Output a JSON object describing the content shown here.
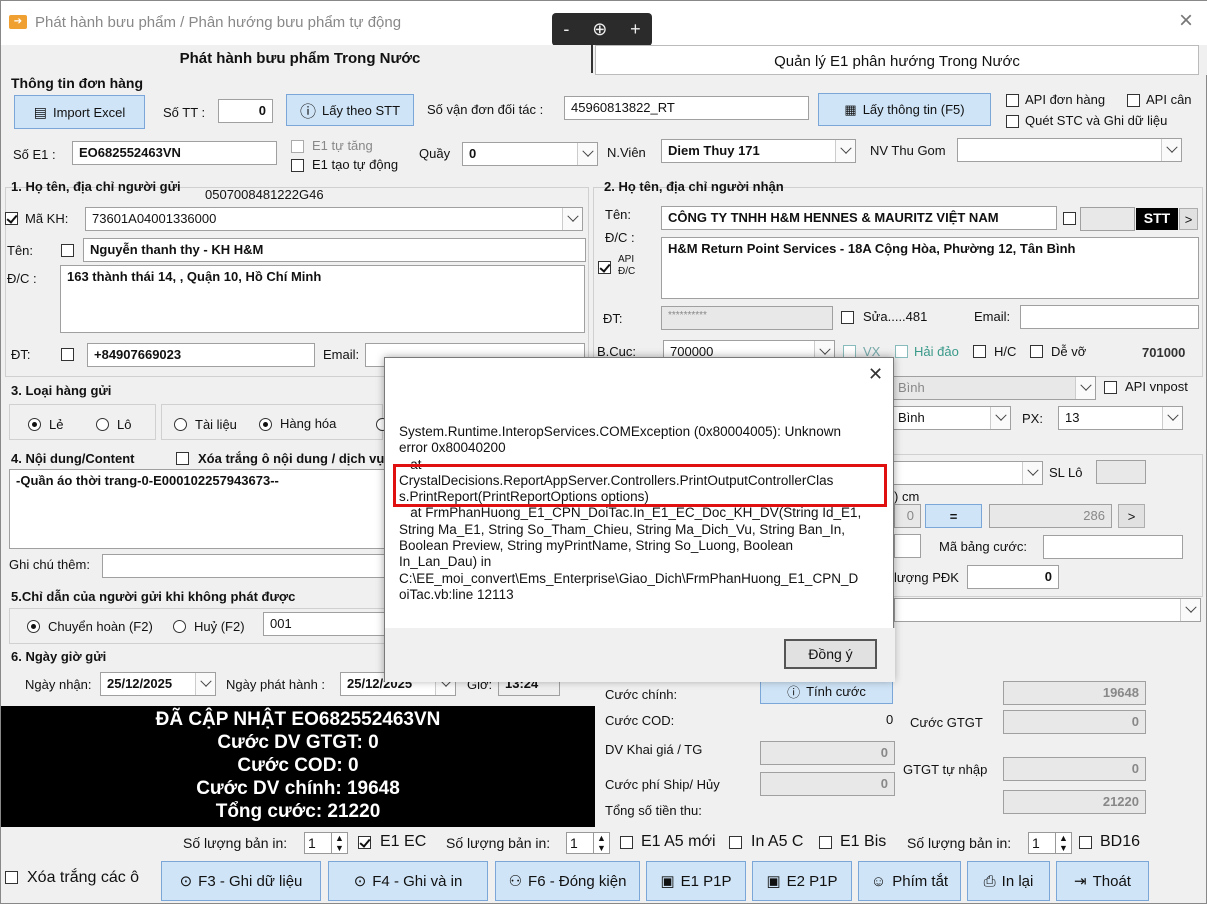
{
  "window": {
    "title": "Phát hành bưu phẩm / Phân hướng bưu phẩm tự động",
    "close": "×"
  },
  "zoom": {
    "minus": "-",
    "plus": "+"
  },
  "tabs": [
    "Phát hành bưu phẩm Trong Nước",
    "Quản lý E1 phân hướng Trong Nước"
  ],
  "order": {
    "section": "Thông tin đơn hàng",
    "import_label": "Import Excel",
    "stt_label": "Số TT :",
    "stt_value": "0",
    "get_by_stt": "Lấy theo STT",
    "partner_label": "Số vận đơn đối tác :",
    "partner_value": "45960813822_RT",
    "get_info": "Lấy thông tin (F5)",
    "api_order": "API đơn hàng",
    "api_scale": "API cân",
    "scan_stc": "Quét STC và Ghi dữ liệu"
  },
  "e1": {
    "label": "Số E1 :",
    "value": "EO682552463VN",
    "auto_inc": "E1 tự tăng",
    "auto_create": "E1 tạo tự động",
    "counter_label": "Quầy",
    "counter_value": "0",
    "staff_label": "N.Viên",
    "staff_value": "Diem Thuy 171",
    "collector_label": "NV Thu Gom",
    "collector_value": ""
  },
  "sender": {
    "section": "1. Họ tên, địa chỉ người gửi",
    "ref": "0507008481222G46",
    "customer_label": "Mã KH:",
    "customer_value": "73601A04001336000",
    "name_label": "Tên:",
    "name_value": "Nguyễn thanh thy - KH H&M",
    "addr_label": "Đ/C :",
    "addr_value": "163 thành thái 14, , Quận 10, Hồ Chí Minh",
    "phone_label": "ĐT:",
    "phone_value": "+84907669023",
    "email_label": "Email:"
  },
  "receiver": {
    "section": "2. Họ tên, địa chỉ người nhận",
    "name_label": "Tên:",
    "name_value": "CÔNG TY TNHH H&M HENNES & MAURITZ VIỆT NAM",
    "stt": "STT",
    "next": ">",
    "addr_label": "Đ/C :",
    "addr_value": "H&M Return Point Services - 18A Cộng Hòa, Phường 12, Tân Bình",
    "api_dc": "API Đ/C",
    "phone_label": "ĐT:",
    "phone_value": "**********",
    "edit_label": "Sửa.....481",
    "email_label": "Email:",
    "bc_label": "B.Cục:",
    "bc_value": "700000",
    "vx": "VX",
    "island": "Hải đảo",
    "hc": "H/C",
    "fragile": "Dễ vỡ",
    "post_code": "701000",
    "district_value": "Bình",
    "api_vnpost": "API vnpost",
    "ward_value": "Bình",
    "px_label": "PX:",
    "px_value": "13"
  },
  "goods": {
    "section": "3. Loại hàng gửi",
    "single": "Lẻ",
    "lot": "Lô",
    "docs": "Tài liệu",
    "goods": "Hàng hóa"
  },
  "content": {
    "section": "4. Nội dung/Content",
    "clear_label": "Xóa trắng ô nội dung / dịch vụ",
    "value": "-Quần áo thời trang-0-E000102257943673--",
    "note_label": "Ghi chú thêm:"
  },
  "service": {
    "sl_lo": "SL Lô",
    "cm": ") cm",
    "dim_value": "0",
    "equals": "=",
    "result": "286",
    "next": ">",
    "price_table_label": "Mã bảng cước:",
    "pdk_label": "lượng PĐK",
    "pdk_value": "0"
  },
  "undeliver": {
    "section": "5.Chỉ dẫn của người gửi khi không phát được",
    "return": "Chuyển hoàn (F2)",
    "cancel": "Huỷ (F2)",
    "code": "001"
  },
  "dates": {
    "section": "6. Ngày giờ gửi",
    "recv_label": "Ngày nhận:",
    "recv_value": "25/12/2025",
    "issue_label": "Ngày phát hành :",
    "issue_value": "25/12/2025",
    "time_label": "Giờ:",
    "time_value": "13:24"
  },
  "fees": {
    "main_label": "Cước chính:",
    "calc_button": "Tính cước",
    "main_value": "19648",
    "cod_label": "Cước COD:",
    "cod_value": "0",
    "gtgt_label": "Cước GTGT",
    "gtgt_value": "0",
    "declared_label": "DV Khai giá / TG",
    "declared_value": "0",
    "gtgt_input_label": "GTGT tự nhập",
    "gtgt_input_value": "0",
    "ship_label": "Cước phí Ship/ Hủy",
    "ship_value": "0",
    "total_label": "Tổng số tiền thu:",
    "total_value": "21220"
  },
  "status": [
    "ĐÃ CẬP NHẬT EO682552463VN",
    "Cước DV GTGT: 0",
    "Cước COD: 0",
    "Cước DV chính: 19648",
    "Tổng cước: 21220"
  ],
  "print": {
    "qty_label": "Số lượng bản in:",
    "qty1": "1",
    "e1ec": "E1 EC",
    "qty2": "1",
    "e1a5": "E1 A5 mới",
    "ina5c": "In A5 C",
    "e1bis": "E1 Bis",
    "qty3": "1",
    "bd16": "BD16"
  },
  "footer": {
    "clear_all": "Xóa trắng các ô",
    "f3": "F3 - Ghi dữ liệu",
    "f4": "F4 - Ghi và in",
    "f6": "F6 - Đóng kiện",
    "e1p1p": "E1 P1P",
    "e2p1p": "E2 P1P",
    "shortcut": "Phím tắt",
    "reprint": "In lại",
    "exit": "Thoát"
  },
  "dialog": {
    "close": "✕",
    "line1": "System.Runtime.InteropServices.COMException (0x80004005): Unknown",
    "line2": "error 0x80040200",
    "line3": "   at",
    "line4": "CrystalDecisions.ReportAppServer.Controllers.PrintOutputControllerClas",
    "line5": "s.PrintReport(PrintReportOptions options)",
    "line6": "   at FrmPhanHuong_E1_CPN_DoiTac.In_E1_EC_Doc_KH_DV(String Id_E1,",
    "line7": "String Ma_E1, String So_Tham_Chieu, String Ma_Dich_Vu, String Ban_In,",
    "line8": "Boolean Preview, String myPrintName, String So_Luong, Boolean",
    "line9": "In_Lan_Dau) in",
    "line10": "C:\\EE_moi_convert\\Ems_Enterprise\\Giao_Dich\\FrmPhanHuong_E1_CPN_D",
    "line11": "oiTac.vb:line 12113",
    "ok": "Đồng ý"
  }
}
